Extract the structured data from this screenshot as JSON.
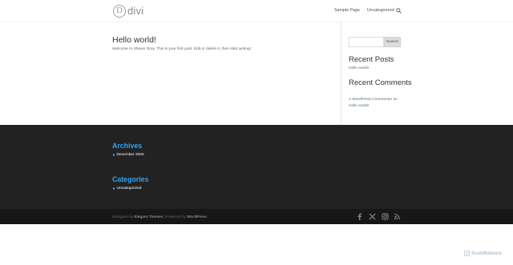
{
  "header": {
    "logo_letter": "D",
    "logo_text": "divi",
    "nav": [
      {
        "label": "Sample Page"
      },
      {
        "label": "Uncategorized"
      }
    ]
  },
  "post": {
    "title": "Hello world!",
    "text": "Welcome to Shawn Gray. This is your first post. Edit or delete it, then start writing!"
  },
  "sidebar": {
    "search_button": "Search",
    "search_placeholder": "",
    "recent_posts_title": "Recent Posts",
    "recent_posts": [
      "Hello world!"
    ],
    "recent_comments_title": "Recent Comments",
    "recent_comment_line1": "A WordPress Commenter on",
    "recent_comment_line2": "Hello world!"
  },
  "footer": {
    "archives_title": "Archives",
    "archives_item": "December 2025",
    "categories_title": "Categories",
    "categories_item": "Uncategorized",
    "accent_color": "#2ea3f2"
  },
  "bottom_bar": {
    "designed_by": "Designed by",
    "elegant_themes": "Elegant Themes",
    "separator": " | Powered by",
    "wordpress": "WordPress",
    "social_icons": [
      "facebook-icon",
      "x-icon",
      "instagram-icon",
      "rss-icon"
    ]
  },
  "watermark": {
    "text": "ScanMalware"
  }
}
